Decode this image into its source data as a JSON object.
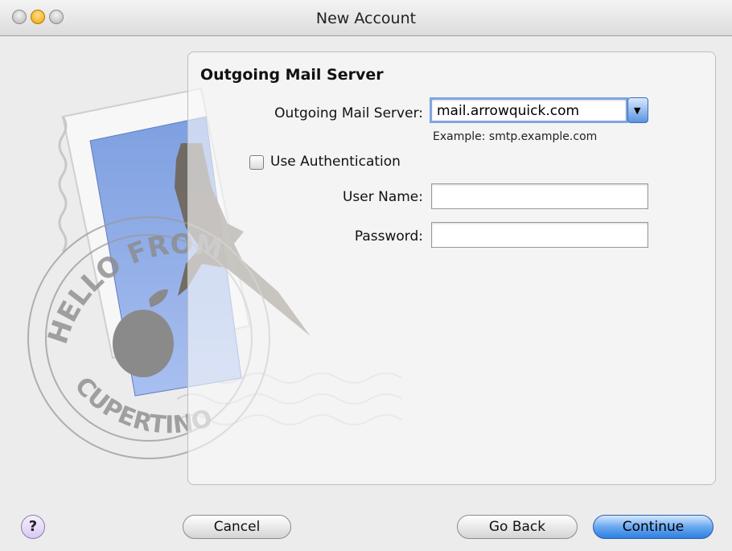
{
  "window": {
    "title": "New Account"
  },
  "form": {
    "section_title": "Outgoing Mail Server",
    "server_label": "Outgoing Mail Server:",
    "server_value": "mail.arrowquick.com",
    "server_hint": "Example: smtp.example.com",
    "use_auth_label": "Use Authentication",
    "use_auth_checked": false,
    "username_label": "User Name:",
    "username_value": "",
    "password_label": "Password:",
    "password_value": ""
  },
  "artwork": {
    "stamp_text_top": "HELLO FROM",
    "stamp_text_bottom": "CUPERTINO CA"
  },
  "buttons": {
    "help_label": "?",
    "cancel_label": "Cancel",
    "go_back_label": "Go Back",
    "continue_label": "Continue"
  },
  "colors": {
    "accent": "#3d7fe0",
    "focus_ring": "#7ea6e0",
    "window_bg": "#ececec"
  }
}
